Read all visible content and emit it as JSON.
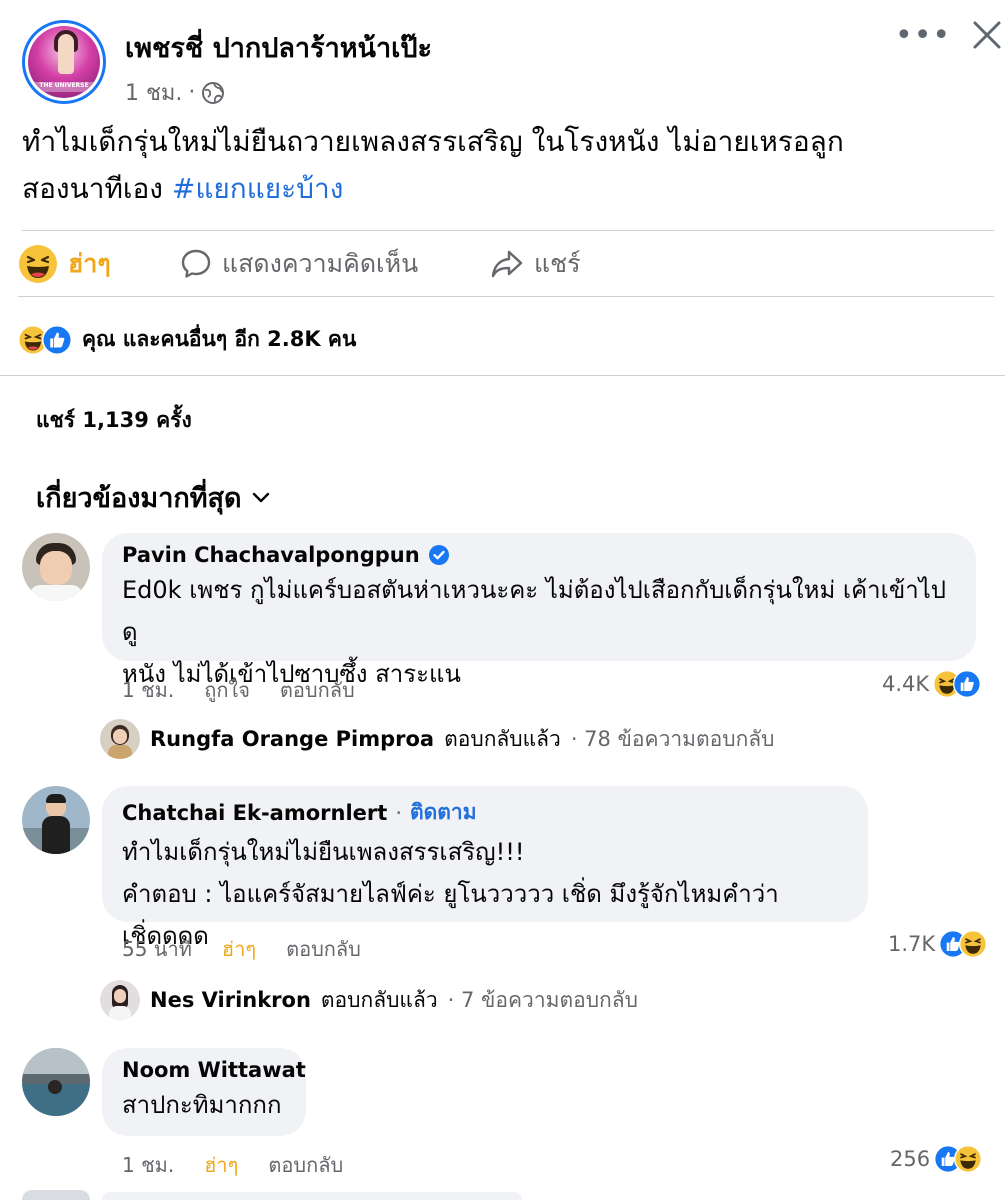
{
  "post": {
    "author": "เพชรชี่ ปากปลาร้าหน้าเป๊ะ",
    "time": "1 ชม.",
    "separator": "·",
    "text_line1": "ทำไมเด็กรุ่นใหม่ไม่ยืนถวายเพลงสรรเสริญ ในโรงหนัง ไม่อายเหรอลูก",
    "text_line2": "สองนาทีเอง ",
    "hashtag": "#แยกแยะบ้าง",
    "avatar_text": "THE UNIVERSE"
  },
  "actions": {
    "haha_label": "ฮ่าๆ",
    "comment_label": "แสดงความคิดเห็น",
    "share_label": "แชร์"
  },
  "reactions_summary": "คุณ และคนอื่นๆ อีก 2.8K คน",
  "shares_count": "แชร์ 1,139 ครั้ง",
  "sort_label": "เกี่ยวข้องมากที่สุด",
  "comments": [
    {
      "author": "Pavin Chachavalpongpun",
      "text_line1": "Ed0k เพชร กูไม่แคร์บอสตันห่าเหวนะคะ ไม่ต้องไปเสือกกับเด็กรุ่นใหม่ เค้าเข้าไปดู",
      "text_line2": "หนัง ไม่ได้เข้าไปซาบซึ้ง สาระแน",
      "time": "1 ชม.",
      "like_label": "ถูกใจ",
      "reply_label": "ตอบกลับ",
      "reaction_count": "4.4K",
      "reply": {
        "name": "Rungfa Orange Pimproa",
        "action": "ตอบกลับแล้ว",
        "meta": "· 78 ข้อความตอบกลับ"
      }
    },
    {
      "author": "Chatchai Ek-amornlert",
      "dot": "·",
      "follow_label": "ติดตาม",
      "text_line1": "ทำไมเด็กรุ่นใหม่ไม่ยืนเพลงสรรเสริญ!!!",
      "text_line2": "คำตอบ : ไอแคร์จัสมายไลฟ์ค่ะ ยูโนววววว เชิ่ด มึงรู้จักไหมคำว่า เชิ่ดดดด",
      "time": "55 นาที",
      "like_label": "ฮ่าๆ",
      "reply_label": "ตอบกลับ",
      "reaction_count": "1.7K",
      "reply": {
        "name": "Nes Virinkron",
        "action": "ตอบกลับแล้ว",
        "meta": "· 7 ข้อความตอบกลับ"
      }
    },
    {
      "author": "Noom Wittawat",
      "text_line1": "สาปกะทิมากกก",
      "time": "1 ชม.",
      "like_label": "ฮ่าๆ",
      "reply_label": "ตอบกลับ",
      "reaction_count": "256"
    }
  ],
  "colors": {
    "accent_blue": "#1877f2",
    "link_blue": "#216fdb",
    "haha_yellow": "#f0a71c",
    "secondary_text": "#65676b",
    "bubble_bg": "#f0f2f5"
  }
}
